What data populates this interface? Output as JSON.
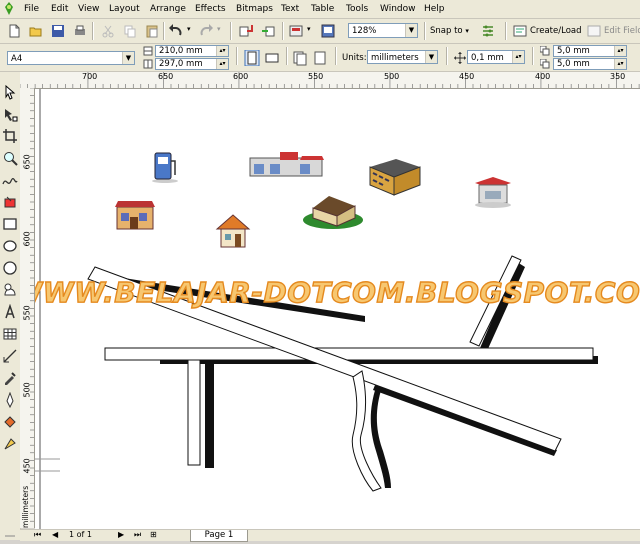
{
  "menu": {
    "items": [
      "File",
      "Edit",
      "View",
      "Layout",
      "Arrange",
      "Effects",
      "Bitmaps",
      "Text",
      "Table",
      "Tools",
      "Window",
      "Help"
    ]
  },
  "toolbar": {
    "zoom_value": "128%",
    "snap_label": "Snap to",
    "create_load_label": "Create/Load",
    "edit_fields_label": "Edit Fields"
  },
  "propertybar": {
    "paper_size": "A4",
    "width_value": "210,0 mm",
    "height_value": "297,0 mm",
    "units_label": "Units:",
    "units_value": "millimeters",
    "nudge_value": "0,1 mm",
    "dup_x_value": "5,0 mm",
    "dup_y_value": "5,0 mm"
  },
  "ruler": {
    "h_ticks": [
      "700",
      "650",
      "600",
      "550",
      "500",
      "450",
      "400",
      "350"
    ],
    "v_ticks": [
      "650",
      "600",
      "550",
      "500",
      "450"
    ],
    "v_unit": "millimeters"
  },
  "canvas": {
    "watermark": "WWW.BELAJAR-DOTCOM.BLOGSPOT.COM",
    "icons": [
      "gas-pump-icon",
      "shop-building-icon",
      "office-building-icon",
      "hotel-icon",
      "gas-station-icon",
      "store-icon",
      "house-icon",
      "villa-icon"
    ]
  },
  "statusbar": {
    "page_count": "1 of 1",
    "page_tab": "Page 1"
  },
  "colors": {
    "chrome": "#ece9d8",
    "watermark_fill": "#f7c770",
    "watermark_stroke": "#e58a1f"
  }
}
